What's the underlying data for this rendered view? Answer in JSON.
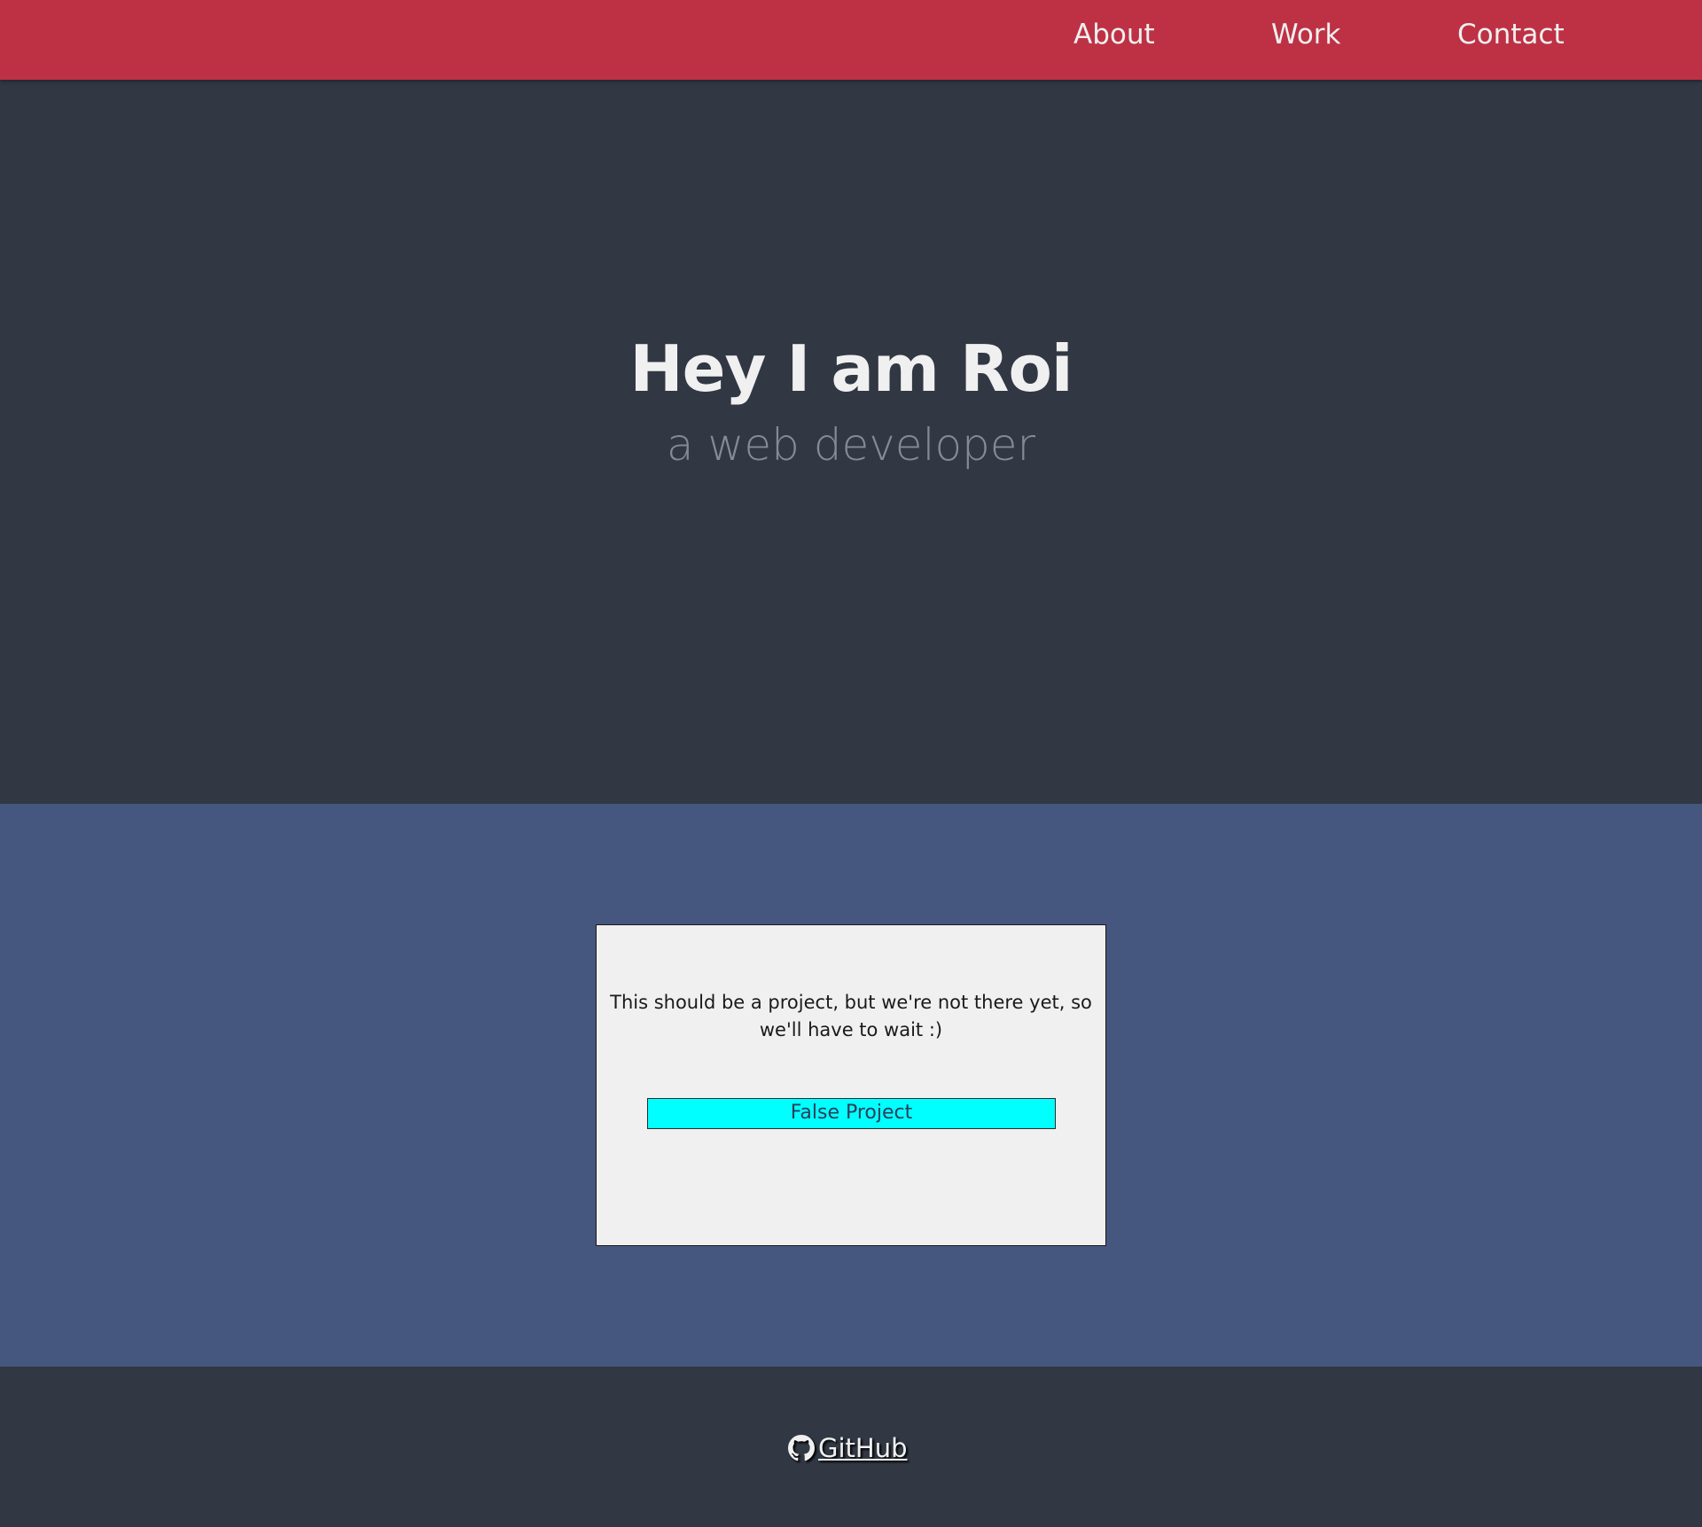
{
  "nav": {
    "items": [
      {
        "label": "About"
      },
      {
        "label": "Work"
      },
      {
        "label": "Contact"
      }
    ]
  },
  "hero": {
    "title": "Hey I am Roi",
    "subtitle": "a web developer"
  },
  "projects": {
    "card": {
      "description": "This should be a project, but we're not there yet, so we'll have to wait :)",
      "button_label": "False Project"
    }
  },
  "footer": {
    "github_label": " GitHub",
    "github_icon": "github-icon"
  },
  "colors": {
    "nav_bg": "#be3144",
    "hero_bg": "#313843",
    "projects_bg": "#45577e",
    "card_bg": "#f0f0f0",
    "button_bg": "#00ffff",
    "footer_bg": "#313843"
  }
}
